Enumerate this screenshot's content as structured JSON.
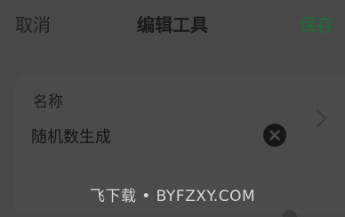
{
  "header": {
    "cancel_label": "取消",
    "title": "编辑工具",
    "save_label": "保存"
  },
  "form": {
    "name_label": "名称",
    "name_value": "随机数生成"
  },
  "icons": {
    "clear": "close-circle-icon",
    "chevron": "chevron-right-icon"
  },
  "watermark": "飞下载 • BYFZXY.COM",
  "colors": {
    "background": "#484848",
    "save_accent": "#1f6b3a",
    "watermark": "#d6d6d6"
  }
}
